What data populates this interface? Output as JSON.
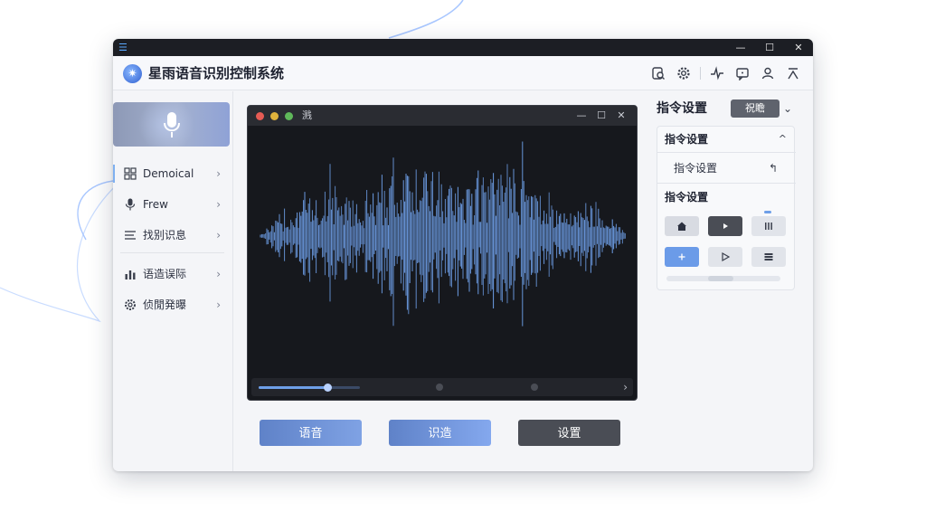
{
  "window": {
    "controls": {
      "minimize": "—",
      "maximize": "☐",
      "close": "✕"
    }
  },
  "app": {
    "title": "星雨语音识别控制系统",
    "logo_icon": "starburst-icon",
    "header_icons": [
      "search-doc-icon",
      "gear-icon",
      "waveform-icon",
      "message-icon",
      "user-icon",
      "collapse-icon"
    ]
  },
  "sidebar": {
    "items": [
      {
        "label": "Demoical",
        "icon": "grid-icon"
      },
      {
        "label": "Frew",
        "icon": "mic-icon"
      },
      {
        "label": "找别识息",
        "icon": "list-icon"
      },
      {
        "label": "语造误际",
        "icon": "bar-chart-icon"
      },
      {
        "label": "侦閒発曝",
        "icon": "gear-icon"
      }
    ],
    "chevron": "›"
  },
  "waveform_window": {
    "title": "溅",
    "controls": {
      "minimize": "—",
      "maximize": "☐",
      "close": "✕"
    },
    "playback_progress": 0.68,
    "next_glyph": "›",
    "accent": "#6e9fe8"
  },
  "buttons": {
    "left": "语音",
    "middle": "识造",
    "right": "设置"
  },
  "right_panel": {
    "title": "指令设置",
    "dropdown": "祝瞻",
    "chevron": "⌄",
    "section1": {
      "header": "指令设置",
      "caret": "^",
      "row_label": "指令设置",
      "row_icon": "↰"
    },
    "section2": {
      "header": "指令设置"
    }
  },
  "colors": {
    "accent": "#6e9fe8",
    "dark_button": "#4a4d55",
    "blue_button": "#6b8fd6"
  }
}
